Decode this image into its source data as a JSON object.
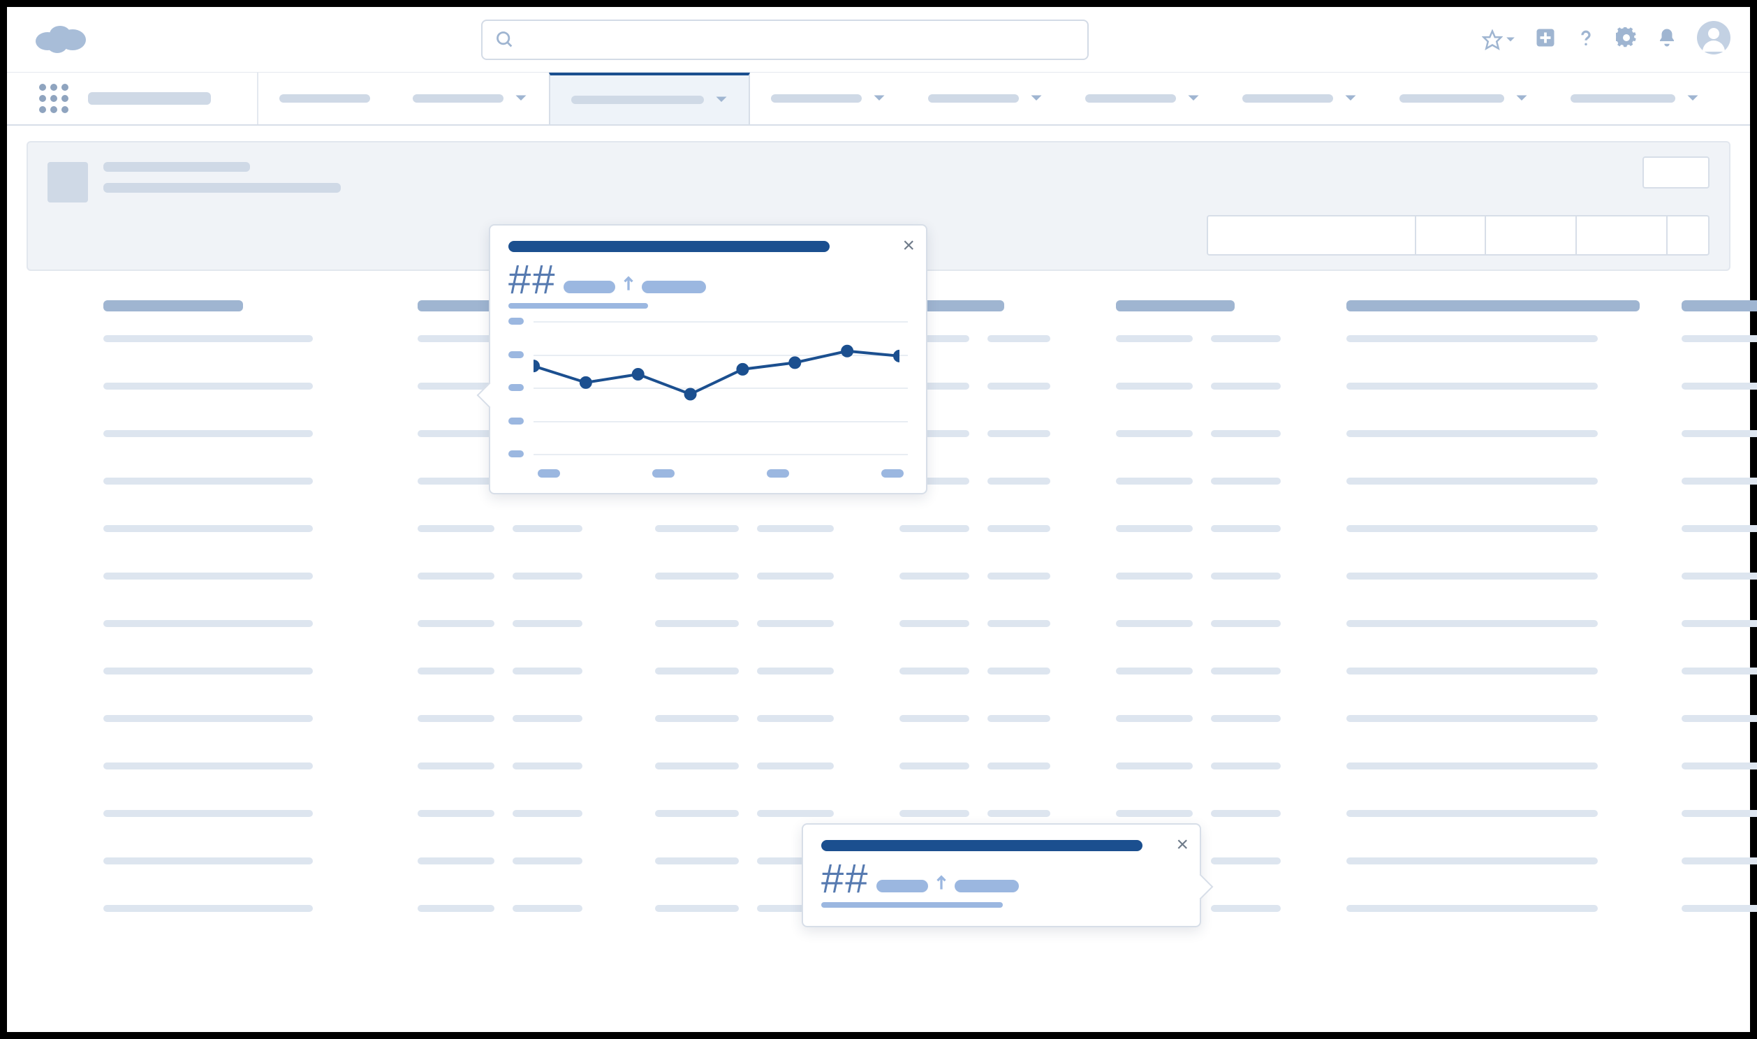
{
  "header": {
    "search_placeholder": "",
    "icons": [
      "favorites",
      "add",
      "help",
      "setup",
      "notifications",
      "profile"
    ]
  },
  "nav": {
    "app_name_placeholder": "",
    "tabs": [
      {
        "label": "",
        "active": false
      },
      {
        "label": "",
        "active": false
      },
      {
        "label": "",
        "active": true
      },
      {
        "label": "",
        "active": false
      },
      {
        "label": "",
        "active": false
      },
      {
        "label": "",
        "active": false
      },
      {
        "label": "",
        "active": false
      },
      {
        "label": "",
        "active": false
      },
      {
        "label": "",
        "active": false
      }
    ]
  },
  "page_header": {
    "title": "",
    "subtitle": "",
    "button_widths": [
      300,
      100,
      130,
      130,
      60
    ]
  },
  "columns": 7,
  "rows": 13,
  "popover_large": {
    "title": "",
    "metric": "##",
    "delta_direction": "up",
    "chart_data": {
      "type": "line",
      "x": [
        1,
        2,
        3,
        4,
        5,
        6,
        7,
        8
      ],
      "values": [
        53,
        43,
        48,
        36,
        51,
        55,
        62,
        59
      ],
      "ylim": [
        0,
        80
      ],
      "y_ticks": [
        0,
        20,
        40,
        60,
        80
      ],
      "x_tick_count": 4
    }
  },
  "popover_small": {
    "title": "",
    "metric": "##",
    "delta_direction": "up"
  }
}
